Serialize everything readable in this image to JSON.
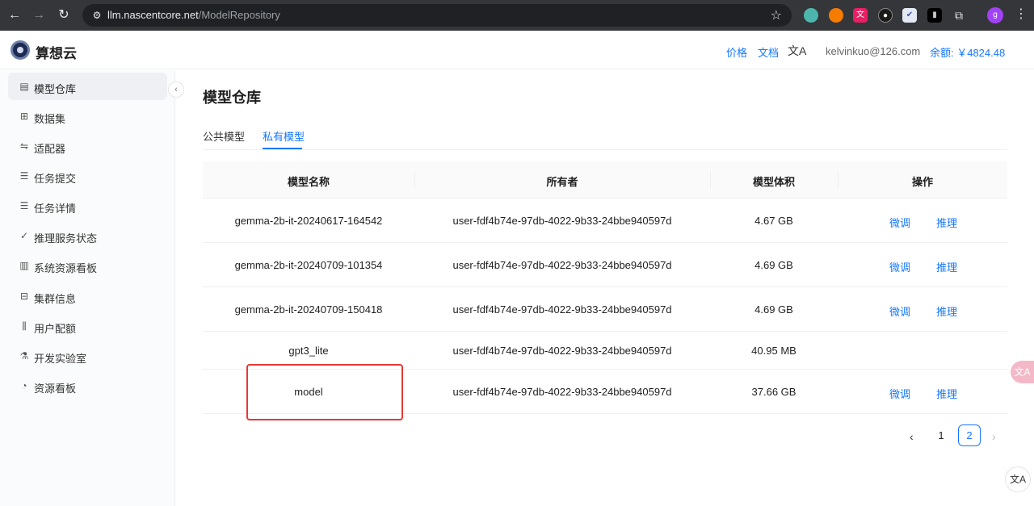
{
  "browser": {
    "url_host": "llm.nascentcore.net",
    "url_path": "/ModelRepository",
    "profile_initial": "g"
  },
  "header": {
    "brand": "算想云",
    "links": [
      "价格",
      "文档"
    ],
    "user_email": "kelvinkuo@126.com",
    "balance": "余额: ￥4824.48"
  },
  "sidebar": {
    "items": [
      {
        "label": "模型仓库",
        "icon": "document-icon"
      },
      {
        "label": "数据集",
        "icon": "grid-icon"
      },
      {
        "label": "适配器",
        "icon": "swap-icon"
      },
      {
        "label": "任务提交",
        "icon": "list-icon"
      },
      {
        "label": "任务详情",
        "icon": "list-icon"
      },
      {
        "label": "推理服务状态",
        "icon": "check-circle-icon"
      },
      {
        "label": "系统资源看板",
        "icon": "bar-chart-icon"
      },
      {
        "label": "集群信息",
        "icon": "cluster-icon"
      },
      {
        "label": "用户配额",
        "icon": "sliders-icon"
      },
      {
        "label": "开发实验室",
        "icon": "flask-icon"
      },
      {
        "label": "资源看板",
        "icon": "dashboard-icon"
      }
    ]
  },
  "main": {
    "title": "模型仓库",
    "tabs": [
      {
        "label": "公共模型"
      },
      {
        "label": "私有模型"
      }
    ],
    "table": {
      "columns": [
        "模型名称",
        "所有者",
        "模型体积",
        "操作"
      ],
      "rows": [
        {
          "name": "gemma-2b-it-20240617-164542",
          "owner": "user-fdf4b74e-97db-4022-9b33-24bbe940597d",
          "size": "4.67 GB",
          "actions": [
            "微调",
            "推理"
          ]
        },
        {
          "name": "gemma-2b-it-20240709-101354",
          "owner": "user-fdf4b74e-97db-4022-9b33-24bbe940597d",
          "size": "4.69 GB",
          "actions": [
            "微调",
            "推理"
          ]
        },
        {
          "name": "gemma-2b-it-20240709-150418",
          "owner": "user-fdf4b74e-97db-4022-9b33-24bbe940597d",
          "size": "4.69 GB",
          "actions": [
            "微调",
            "推理"
          ]
        },
        {
          "name": "gpt3_lite",
          "owner": "user-fdf4b74e-97db-4022-9b33-24bbe940597d",
          "size": "40.95 MB",
          "actions": []
        },
        {
          "name": "model",
          "owner": "user-fdf4b74e-97db-4022-9b33-24bbe940597d",
          "size": "37.66 GB",
          "actions": [
            "微调",
            "推理"
          ]
        }
      ]
    },
    "pagination": {
      "pages": [
        "1",
        "2"
      ],
      "current": "2"
    }
  }
}
